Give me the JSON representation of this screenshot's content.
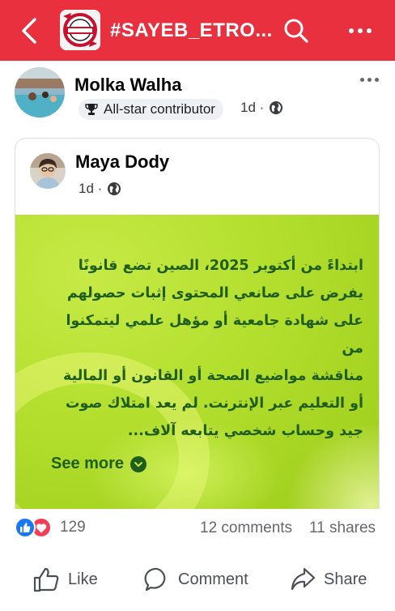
{
  "header": {
    "group_title": "#SAYEB_ETRO...",
    "accent_color": "#e8303e",
    "icons": [
      "back-arrow-icon",
      "group-logo",
      "search-icon",
      "more-options-icon"
    ]
  },
  "post": {
    "author": "Molka Walha",
    "badge": "All-star contributor",
    "time": "1d ·",
    "shared": {
      "author": "Maya Dody",
      "time": "1d ·",
      "lines": [
        "ابتداءً من أكتوبر 2025، الصين تضع قانونًا",
        "يفرض على صانعي المحتوى إثبات حصولهم",
        "على شهادة جامعية أو مؤهل علمي ليتمكنوا من",
        "مناقشة مواضيع الصحة أو القانون أو المالية",
        "أو التعليم عبر الإنترنت. لم يعد امتلاك صوت",
        "جيد وحساب شخصي يتابعه آلاف..."
      ],
      "see_more": "See more",
      "background_color": "#b5e030",
      "text_color": "#1f5e1a"
    },
    "stats": {
      "reactions_count": "129",
      "comments": "12 comments",
      "shares": "11 shares"
    },
    "actions": {
      "like": "Like",
      "comment": "Comment",
      "share": "Share"
    }
  }
}
